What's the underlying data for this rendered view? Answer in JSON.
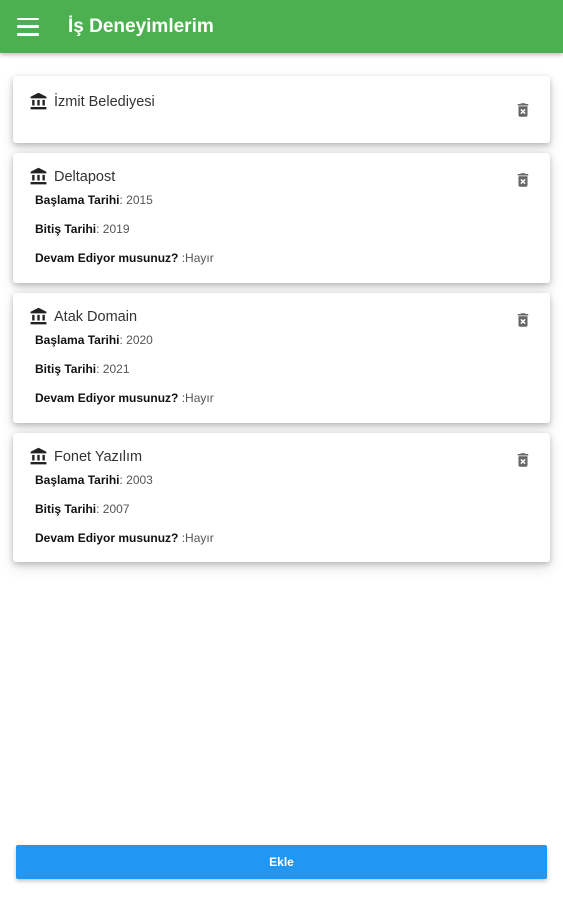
{
  "appbar": {
    "title": "İş Deneyimlerim",
    "color": "#4caf50"
  },
  "labels": {
    "start": "Başlama Tarihi",
    "end": "Bitiş Tarihi",
    "ongoing": "Devam Ediyor musunuz?"
  },
  "experiences": [
    {
      "company": "İzmit Belediyesi"
    },
    {
      "company": "Deltapost",
      "start": ": 2015",
      "end": ": 2019",
      "ongoing": " :Hayır"
    },
    {
      "company": "Atak Domain",
      "start": ": 2020",
      "end": ": 2021",
      "ongoing": " :Hayır"
    },
    {
      "company": "Fonet Yazılım",
      "start": ": 2003",
      "end": ": 2007",
      "ongoing": " :Hayır"
    }
  ],
  "add_button": {
    "label": "Ekle",
    "color": "#2196f3"
  },
  "icons": {
    "menu": "menu-icon",
    "company": "bank-icon",
    "delete": "delete-icon"
  }
}
